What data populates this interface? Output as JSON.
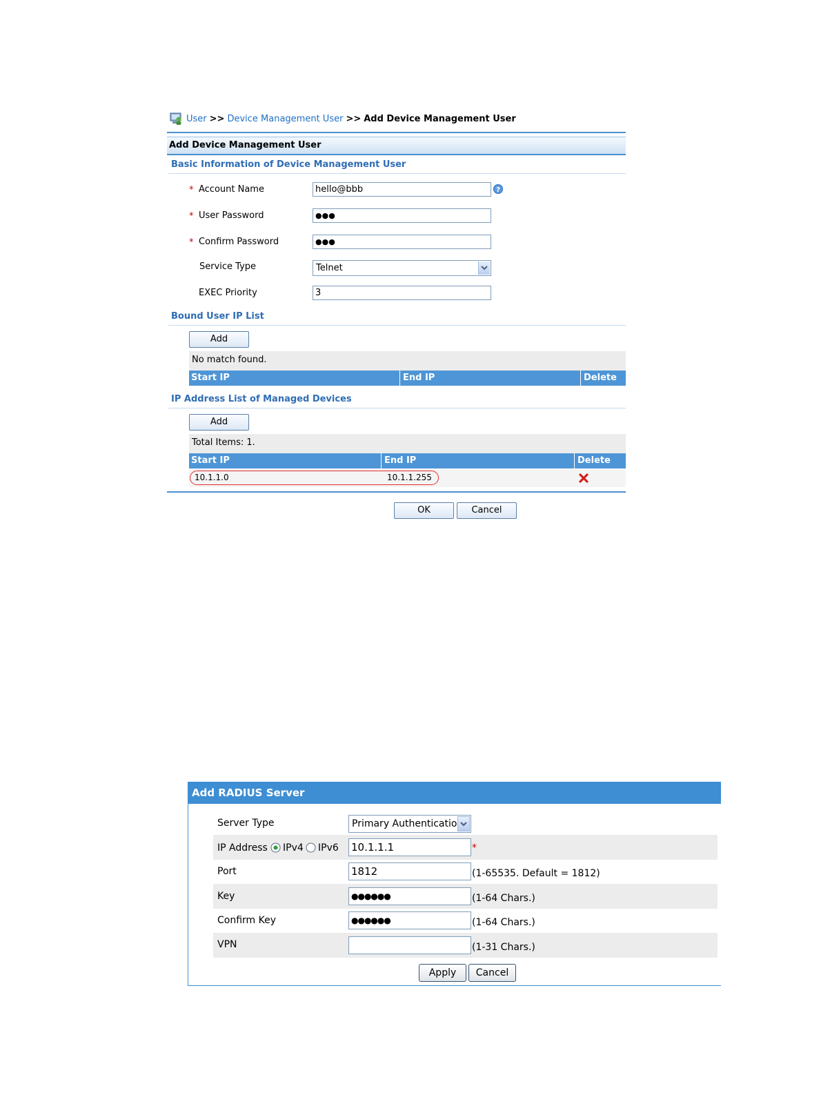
{
  "top": {
    "breadcrumb": {
      "item1": "User",
      "sep1": ">>",
      "item2": "Device Management User",
      "sep2": ">>",
      "current": "Add Device Management User"
    },
    "panel_title": "Add Device Management User",
    "basic_section_title": "Basic Information of Device Management User",
    "fields": {
      "account_name_label": "Account Name",
      "account_name_value": "hello@bbb",
      "user_password_label": "User Password",
      "user_password_value": "●●●",
      "confirm_password_label": "Confirm Password",
      "confirm_password_value": "●●●",
      "service_type_label": "Service Type",
      "service_type_value": "Telnet",
      "exec_priority_label": "EXEC Priority",
      "exec_priority_value": "3",
      "required_mark": "*"
    },
    "bound_ip": {
      "section_title": "Bound User IP List",
      "add_label": "Add",
      "status": "No match found.",
      "columns": [
        "Start IP",
        "End IP",
        "Delete"
      ]
    },
    "managed_ip": {
      "section_title": "IP Address List of Managed Devices",
      "add_label": "Add",
      "status": "Total Items: 1.",
      "columns": [
        "Start IP",
        "End IP",
        "Delete"
      ],
      "rows": [
        {
          "start_ip": "10.1.1.0",
          "end_ip": "10.1.1.255"
        }
      ]
    },
    "ok_label": "OK",
    "cancel_label": "Cancel"
  },
  "radius": {
    "title": "Add RADIUS Server",
    "server_type_label": "Server Type",
    "server_type_value": "Primary Authenticatio",
    "ip_label": "IP Address",
    "ipv4_label": "IPv4",
    "ipv6_label": "IPv6",
    "ip_value": "10.1.1.1",
    "required_mark": "*",
    "port_label": "Port",
    "port_value": "1812",
    "port_hint": "(1-65535. Default = 1812)",
    "key_label": "Key",
    "key_value": "●●●●●●",
    "key_hint": "(1-64 Chars.)",
    "confirm_key_label": "Confirm Key",
    "confirm_key_value": "●●●●●●",
    "confirm_key_hint": "(1-64 Chars.)",
    "vpn_label": "VPN",
    "vpn_value": "",
    "vpn_hint": "(1-31 Chars.)",
    "apply_label": "Apply",
    "cancel_label": "Cancel"
  },
  "colors": {
    "header_blue": "#4a8fd0",
    "section_blue": "#2f6db5",
    "table_header": "#4d95d6",
    "radius_header": "#3d8ed3",
    "delete_red": "#d42020"
  },
  "icons": {
    "breadcrumb": "user-computer-icon",
    "help": "help-icon",
    "dropdown": "chevron-down-icon",
    "delete": "delete-x-icon"
  }
}
